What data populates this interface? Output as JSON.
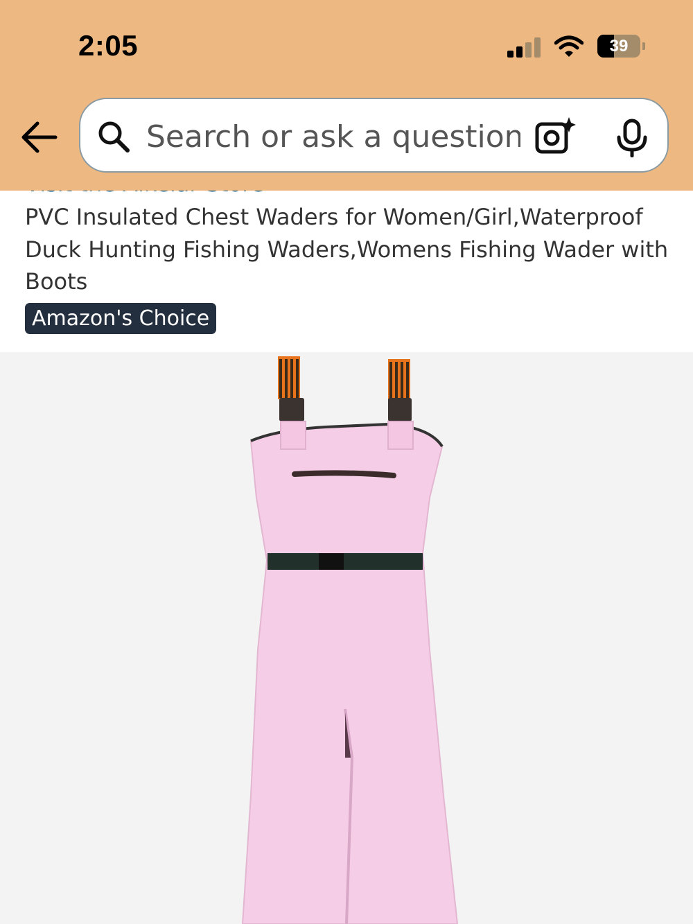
{
  "status_bar": {
    "time": "2:05",
    "battery_percent": "39",
    "battery_level": 0.39
  },
  "search": {
    "placeholder": "Search or ask a question"
  },
  "product": {
    "store_link": "Visit the Aikeiar Store",
    "title": "PVC Insulated Chest Waders for Women/Girl,Waterproof Duck Hunting Fishing Waders,Womens Fishing Wader with Boots",
    "badge": "Amazon's Choice",
    "image_description_color": "#f6cde6"
  },
  "icons": {
    "back": "back-arrow-icon",
    "search": "search-icon",
    "camera": "camera-lens-icon",
    "mic": "microphone-icon"
  },
  "colors": {
    "header_bg": "#edb881",
    "badge_bg": "#232f3e",
    "image_bg": "#f3f3f3",
    "link": "#0b5a8a"
  }
}
